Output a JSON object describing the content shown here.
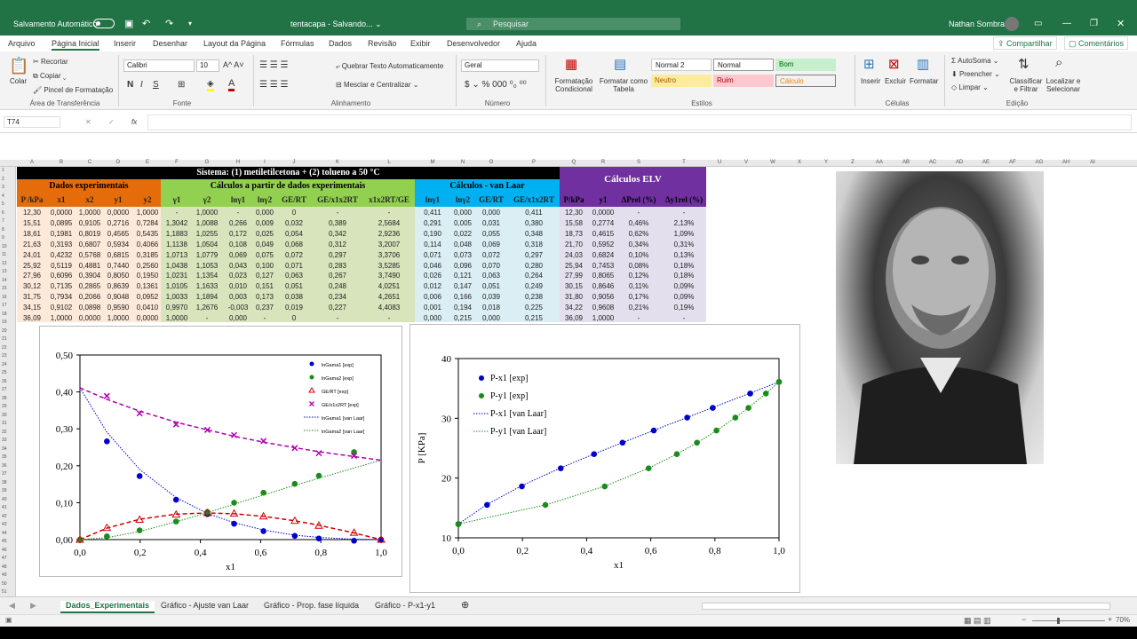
{
  "titlebar": {
    "autosave_label": "Salvamento Automático",
    "title": "tentacapa - Salvando... ⌄",
    "search_placeholder": "Pesquisar",
    "user": "Nathan Sombra"
  },
  "menu": {
    "items": [
      "Arquivo",
      "Página Inicial",
      "Inserir",
      "Desenhar",
      "Layout da Página",
      "Fórmulas",
      "Dados",
      "Revisão",
      "Exibir",
      "Desenvolvedor",
      "Ajuda"
    ],
    "share": "Compartilhar",
    "comments": "Comentários"
  },
  "ribbon": {
    "paste": "Colar",
    "cut": "Recortar",
    "copy": "Copiar",
    "format_painter": "Pincel de Formatação",
    "clipboard_group": "Área de Transferência",
    "font_name": "Calibri",
    "font_size": "10",
    "font_group": "Fonte",
    "wrap_text": "Quebrar Texto Automaticamente",
    "merge_center": "Mesclar e Centralizar",
    "alignment_group": "Alinhamento",
    "number_format": "Geral",
    "number_group": "Número",
    "cond_format": "Formatação Condicional",
    "format_table": "Formatar como Tabela",
    "styles": {
      "normal2": "Normal 2",
      "normal": "Normal",
      "bom": "Bom",
      "neutro": "Neutro",
      "ruim": "Ruim",
      "calculo": "Cálculo"
    },
    "styles_group": "Estilos",
    "insert": "Inserir",
    "delete": "Excluir",
    "format": "Formatar",
    "cells_group": "Células",
    "autosum": "AutoSoma",
    "fill": "Preencher",
    "clear": "Limpar",
    "sort_filter": "Classificar e Filtrar",
    "find_select": "Localizar e Selecionar",
    "editing_group": "Edição",
    "colors": {
      "accent": "#217346",
      "font_red": "#c00000",
      "highlight": "#ffff00"
    }
  },
  "formula_bar": {
    "namebox": "T74",
    "fx": "fx"
  },
  "columns": [
    "A",
    "B",
    "C",
    "D",
    "E",
    "F",
    "G",
    "H",
    "I",
    "J",
    "K",
    "L",
    "M",
    "N",
    "O",
    "P",
    "Q",
    "R",
    "S",
    "T",
    "U",
    "V",
    "W",
    "X",
    "Y",
    "Z",
    "AA",
    "AB",
    "AC",
    "AD",
    "AE",
    "AF",
    "AG",
    "AH",
    "AI"
  ],
  "rows": [
    "1",
    "2",
    "3",
    "4",
    "5",
    "6",
    "7",
    "8",
    "9",
    "10",
    "11",
    "12",
    "13",
    "14",
    "15",
    "16",
    "17",
    "18",
    "19",
    "20",
    "21",
    "22",
    "23",
    "24",
    "25",
    "26",
    "27",
    "28",
    "29",
    "30",
    "31",
    "32",
    "33",
    "34",
    "35",
    "36",
    "37",
    "38",
    "39",
    "40",
    "41",
    "42",
    "43",
    "44",
    "45",
    "46",
    "47",
    "48",
    "49",
    "50",
    "51"
  ],
  "table": {
    "system_title": "Sistema: (1) metiletilcetona + (2) tolueno a 50 °C",
    "exp_title": "Dados experimentais",
    "calc_title": "Cálculos a partir de dados experimentais",
    "vl_title": "Cálculos - van Laar",
    "elv_title": "Cálculos ELV",
    "exp_headers": [
      "P /kPa",
      "x1",
      "x2",
      "y1",
      "y2"
    ],
    "calc_headers": [
      "γ1",
      "γ2",
      "lnγ1",
      "lnγ2",
      "GE/RT",
      "GE/x1x2RT",
      "x1x2RT/GE"
    ],
    "vl_headers": [
      "lnγ1",
      "lnγ2",
      "GE/RT",
      "GE/x1x2RT"
    ],
    "elv_headers": [
      "P/kPa",
      "y1",
      "ΔPrel (%)",
      "Δy1rel (%)"
    ],
    "exp_rows": [
      [
        "12,30",
        "0,0000",
        "1,0000",
        "0,0000",
        "1,0000"
      ],
      [
        "15,51",
        "0,0895",
        "0,9105",
        "0,2716",
        "0,7284"
      ],
      [
        "18,61",
        "0,1981",
        "0,8019",
        "0,4565",
        "0,5435"
      ],
      [
        "21,63",
        "0,3193",
        "0,6807",
        "0,5934",
        "0,4066"
      ],
      [
        "24,01",
        "0,4232",
        "0,5768",
        "0,6815",
        "0,3185"
      ],
      [
        "25,92",
        "0,5119",
        "0,4881",
        "0,7440",
        "0,2560"
      ],
      [
        "27,96",
        "0,6096",
        "0,3904",
        "0,8050",
        "0,1950"
      ],
      [
        "30,12",
        "0,7135",
        "0,2865",
        "0,8639",
        "0,1361"
      ],
      [
        "31,75",
        "0,7934",
        "0,2066",
        "0,9048",
        "0,0952"
      ],
      [
        "34,15",
        "0,9102",
        "0,0898",
        "0,9590",
        "0,0410"
      ],
      [
        "36,09",
        "1,0000",
        "0,0000",
        "1,0000",
        "0,0000"
      ]
    ],
    "calc_rows": [
      [
        "-",
        "1,0000",
        "-",
        "0,000",
        "0",
        "-",
        "-"
      ],
      [
        "1,3042",
        "1,0088",
        "0,266",
        "0,009",
        "0,032",
        "0,389",
        "2,5684"
      ],
      [
        "1,1883",
        "1,0255",
        "0,172",
        "0,025",
        "0,054",
        "0,342",
        "2,9236"
      ],
      [
        "1,1138",
        "1,0504",
        "0,108",
        "0,049",
        "0,068",
        "0,312",
        "3,2007"
      ],
      [
        "1,0713",
        "1,0779",
        "0,069",
        "0,075",
        "0,072",
        "0,297",
        "3,3706"
      ],
      [
        "1,0438",
        "1,1053",
        "0,043",
        "0,100",
        "0,071",
        "0,283",
        "3,5285"
      ],
      [
        "1,0231",
        "1,1354",
        "0,023",
        "0,127",
        "0,063",
        "0,267",
        "3,7490"
      ],
      [
        "1,0105",
        "1,1633",
        "0,010",
        "0,151",
        "0,051",
        "0,248",
        "4,0251"
      ],
      [
        "1,0033",
        "1,1894",
        "0,003",
        "0,173",
        "0,038",
        "0,234",
        "4,2651"
      ],
      [
        "0,9970",
        "1,2676",
        "-0,003",
        "0,237",
        "0,019",
        "0,227",
        "4,4083"
      ],
      [
        "1,0000",
        "-",
        "0,000",
        "-",
        "0",
        "-",
        "-"
      ]
    ],
    "vl_rows": [
      [
        "0,411",
        "0,000",
        "0,000",
        "0,411"
      ],
      [
        "0,291",
        "0,005",
        "0,031",
        "0,380"
      ],
      [
        "0,190",
        "0,022",
        "0,055",
        "0,348"
      ],
      [
        "0,114",
        "0,048",
        "0,069",
        "0,318"
      ],
      [
        "0,071",
        "0,073",
        "0,072",
        "0,297"
      ],
      [
        "0,046",
        "0,096",
        "0,070",
        "0,280"
      ],
      [
        "0,026",
        "0,121",
        "0,063",
        "0,264"
      ],
      [
        "0,012",
        "0,147",
        "0,051",
        "0,249"
      ],
      [
        "0,006",
        "0,166",
        "0,039",
        "0,238"
      ],
      [
        "0,001",
        "0,194",
        "0,018",
        "0,225"
      ],
      [
        "0,000",
        "0,215",
        "0,000",
        "0,215"
      ]
    ],
    "elv_rows": [
      [
        "12,30",
        "0,0000",
        "-",
        "-"
      ],
      [
        "15,58",
        "0,2774",
        "0,46%",
        "2,13%"
      ],
      [
        "18,73",
        "0,4615",
        "0,62%",
        "1,09%"
      ],
      [
        "21,70",
        "0,5952",
        "0,34%",
        "0,31%"
      ],
      [
        "24,03",
        "0,6824",
        "0,10%",
        "0,13%"
      ],
      [
        "25,94",
        "0,7453",
        "0,08%",
        "0,18%"
      ],
      [
        "27,99",
        "0,8065",
        "0,12%",
        "0,18%"
      ],
      [
        "30,15",
        "0,8646",
        "0,11%",
        "0,09%"
      ],
      [
        "31,80",
        "0,9056",
        "0,17%",
        "0,09%"
      ],
      [
        "34,22",
        "0,9608",
        "0,21%",
        "0,19%"
      ],
      [
        "36,09",
        "1,0000",
        "-",
        "-"
      ]
    ],
    "colors": {
      "title_bg": "#000000",
      "exp_bg": "#e46c0a",
      "calc_bg": "#92d050",
      "calc_body": "#d8e4bc",
      "vl_bg": "#00b0f0",
      "vl_body": "#daeef3",
      "elv_bg": "#7030a0",
      "elv_body": "#e4dfec",
      "exp_body": "#fde9d9"
    }
  },
  "chart_data": [
    {
      "type": "scatter",
      "xlabel": "x1",
      "ylabel": "",
      "xlim": [
        0,
        1
      ],
      "ylim": [
        0,
        0.5
      ],
      "xticks": [
        "0,0",
        "0,2",
        "0,4",
        "0,6",
        "0,8",
        "1,0"
      ],
      "yticks": [
        "0,00",
        "0,10",
        "0,20",
        "0,30",
        "0,40",
        "0,50"
      ],
      "legend_position": "top-right",
      "series": [
        {
          "name": "lnGama1 [exp]",
          "color": "#0000cc",
          "marker": "circle",
          "x": [
            0.0895,
            0.1981,
            0.3193,
            0.4232,
            0.5119,
            0.6096,
            0.7135,
            0.7934,
            0.9102,
            1.0
          ],
          "y": [
            0.266,
            0.172,
            0.108,
            0.069,
            0.043,
            0.023,
            0.01,
            0.003,
            -0.003,
            0.0
          ]
        },
        {
          "name": "lnGama2 [exp]",
          "color": "#1a8c1a",
          "marker": "circle",
          "x": [
            0.0,
            0.0895,
            0.1981,
            0.3193,
            0.4232,
            0.5119,
            0.6096,
            0.7135,
            0.7934,
            0.9102
          ],
          "y": [
            0.0,
            0.009,
            0.025,
            0.049,
            0.075,
            0.1,
            0.127,
            0.151,
            0.173,
            0.237
          ]
        },
        {
          "name": "GE/RT [exp]",
          "color": "#d00000",
          "marker": "triangle",
          "x": [
            0.0,
            0.0895,
            0.1981,
            0.3193,
            0.4232,
            0.5119,
            0.6096,
            0.7135,
            0.7934,
            0.9102,
            1.0
          ],
          "y": [
            0,
            0.032,
            0.054,
            0.068,
            0.072,
            0.071,
            0.063,
            0.051,
            0.038,
            0.019,
            0
          ]
        },
        {
          "name": "GE/x1x2RT [exp]",
          "color": "#b000b0",
          "marker": "x",
          "x": [
            0.0895,
            0.1981,
            0.3193,
            0.4232,
            0.5119,
            0.6096,
            0.7135,
            0.7934,
            0.9102
          ],
          "y": [
            0.389,
            0.342,
            0.312,
            0.297,
            0.283,
            0.267,
            0.248,
            0.234,
            0.227
          ]
        },
        {
          "name": "lnGama1 [van Laar]",
          "color": "#0000cc",
          "line": "dotted",
          "x": [
            0.0,
            0.0895,
            0.1981,
            0.3193,
            0.4232,
            0.5119,
            0.6096,
            0.7135,
            0.7934,
            0.9102,
            1.0
          ],
          "y": [
            0.411,
            0.291,
            0.19,
            0.114,
            0.071,
            0.046,
            0.026,
            0.012,
            0.006,
            0.001,
            0.0
          ]
        },
        {
          "name": "lnGama2 [van Laar]",
          "color": "#1a8c1a",
          "line": "dotted",
          "x": [
            0.0,
            0.0895,
            0.1981,
            0.3193,
            0.4232,
            0.5119,
            0.6096,
            0.7135,
            0.7934,
            0.9102,
            1.0
          ],
          "y": [
            0.0,
            0.005,
            0.022,
            0.048,
            0.073,
            0.096,
            0.121,
            0.147,
            0.166,
            0.194,
            0.215
          ]
        },
        {
          "name": "",
          "color": "#d00000",
          "line": "dashed",
          "x": [
            0.0,
            0.0895,
            0.1981,
            0.3193,
            0.4232,
            0.5119,
            0.6096,
            0.7135,
            0.7934,
            0.9102,
            1.0
          ],
          "y": [
            0.0,
            0.031,
            0.055,
            0.069,
            0.072,
            0.07,
            0.063,
            0.051,
            0.039,
            0.018,
            0.0
          ]
        },
        {
          "name": "",
          "color": "#b000b0",
          "line": "dashed",
          "x": [
            0.0,
            0.0895,
            0.1981,
            0.3193,
            0.4232,
            0.5119,
            0.6096,
            0.7135,
            0.7934,
            0.9102,
            1.0
          ],
          "y": [
            0.411,
            0.38,
            0.348,
            0.318,
            0.297,
            0.28,
            0.264,
            0.249,
            0.238,
            0.225,
            0.215
          ]
        }
      ]
    },
    {
      "type": "scatter",
      "xlabel": "x1",
      "ylabel": "P [KPa]",
      "xlim": [
        0,
        1
      ],
      "ylim": [
        10,
        40
      ],
      "xticks": [
        "0,0",
        "0,2",
        "0,4",
        "0,6",
        "0,8",
        "1,0"
      ],
      "yticks": [
        "10",
        "20",
        "30",
        "40"
      ],
      "legend_position": "top-left",
      "series": [
        {
          "name": "P-x1 [exp]",
          "color": "#0000cc",
          "marker": "circle",
          "x": [
            0.0,
            0.0895,
            0.1981,
            0.3193,
            0.4232,
            0.5119,
            0.6096,
            0.7135,
            0.7934,
            0.9102,
            1.0
          ],
          "y": [
            12.3,
            15.51,
            18.61,
            21.63,
            24.01,
            25.92,
            27.96,
            30.12,
            31.75,
            34.15,
            36.09
          ]
        },
        {
          "name": "P-y1 [exp]",
          "color": "#1a8c1a",
          "marker": "circle",
          "x": [
            0.0,
            0.2716,
            0.4565,
            0.5934,
            0.6815,
            0.744,
            0.805,
            0.8639,
            0.9048,
            0.959,
            1.0
          ],
          "y": [
            12.3,
            15.51,
            18.61,
            21.63,
            24.01,
            25.92,
            27.96,
            30.12,
            31.75,
            34.15,
            36.09
          ]
        },
        {
          "name": "P-x1 [van Laar]",
          "color": "#0000cc",
          "line": "dotted",
          "x": [
            0.0,
            0.0895,
            0.1981,
            0.3193,
            0.4232,
            0.5119,
            0.6096,
            0.7135,
            0.7934,
            0.9102,
            1.0
          ],
          "y": [
            12.3,
            15.58,
            18.73,
            21.7,
            24.03,
            25.94,
            27.99,
            30.15,
            31.8,
            34.22,
            36.09
          ]
        },
        {
          "name": "P-y1 [van Laar]",
          "color": "#1a8c1a",
          "line": "dotted",
          "x": [
            0.0,
            0.2774,
            0.4615,
            0.5952,
            0.6824,
            0.7453,
            0.8065,
            0.8646,
            0.9056,
            0.9608,
            1.0
          ],
          "y": [
            12.3,
            15.58,
            18.73,
            21.7,
            24.03,
            25.94,
            27.99,
            30.15,
            31.8,
            34.22,
            36.09
          ]
        }
      ]
    }
  ],
  "tabs": [
    "Dados_Experimentais",
    "Gráfico - Ajuste van Laar",
    "Gráfico - Prop. fase líquida",
    "Gráfico - P-x1-y1"
  ],
  "status": {
    "zoom": "70%"
  }
}
